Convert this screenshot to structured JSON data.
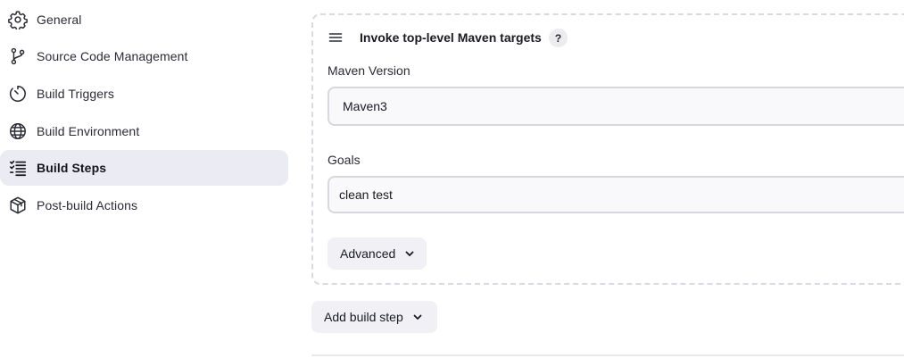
{
  "sidebar": {
    "items": [
      {
        "label": "General",
        "icon": "gear-icon"
      },
      {
        "label": "Source Code Management",
        "icon": "git-branch-icon"
      },
      {
        "label": "Build Triggers",
        "icon": "timer-icon"
      },
      {
        "label": "Build Environment",
        "icon": "globe-icon"
      },
      {
        "label": "Build Steps",
        "icon": "list-icon",
        "active": true
      },
      {
        "label": "Post-build Actions",
        "icon": "package-icon"
      }
    ]
  },
  "build_step": {
    "title": "Invoke top-level Maven targets",
    "help": "?",
    "maven_version_label": "Maven Version",
    "maven_version_value": "Maven3",
    "goals_label": "Goals",
    "goals_value": "clean test",
    "advanced_label": "Advanced"
  },
  "add_build_step_label": "Add build step",
  "colors": {
    "active_bg": "#ebebf3",
    "button_bg": "#f0f0f5",
    "border": "#d7d7e0"
  }
}
